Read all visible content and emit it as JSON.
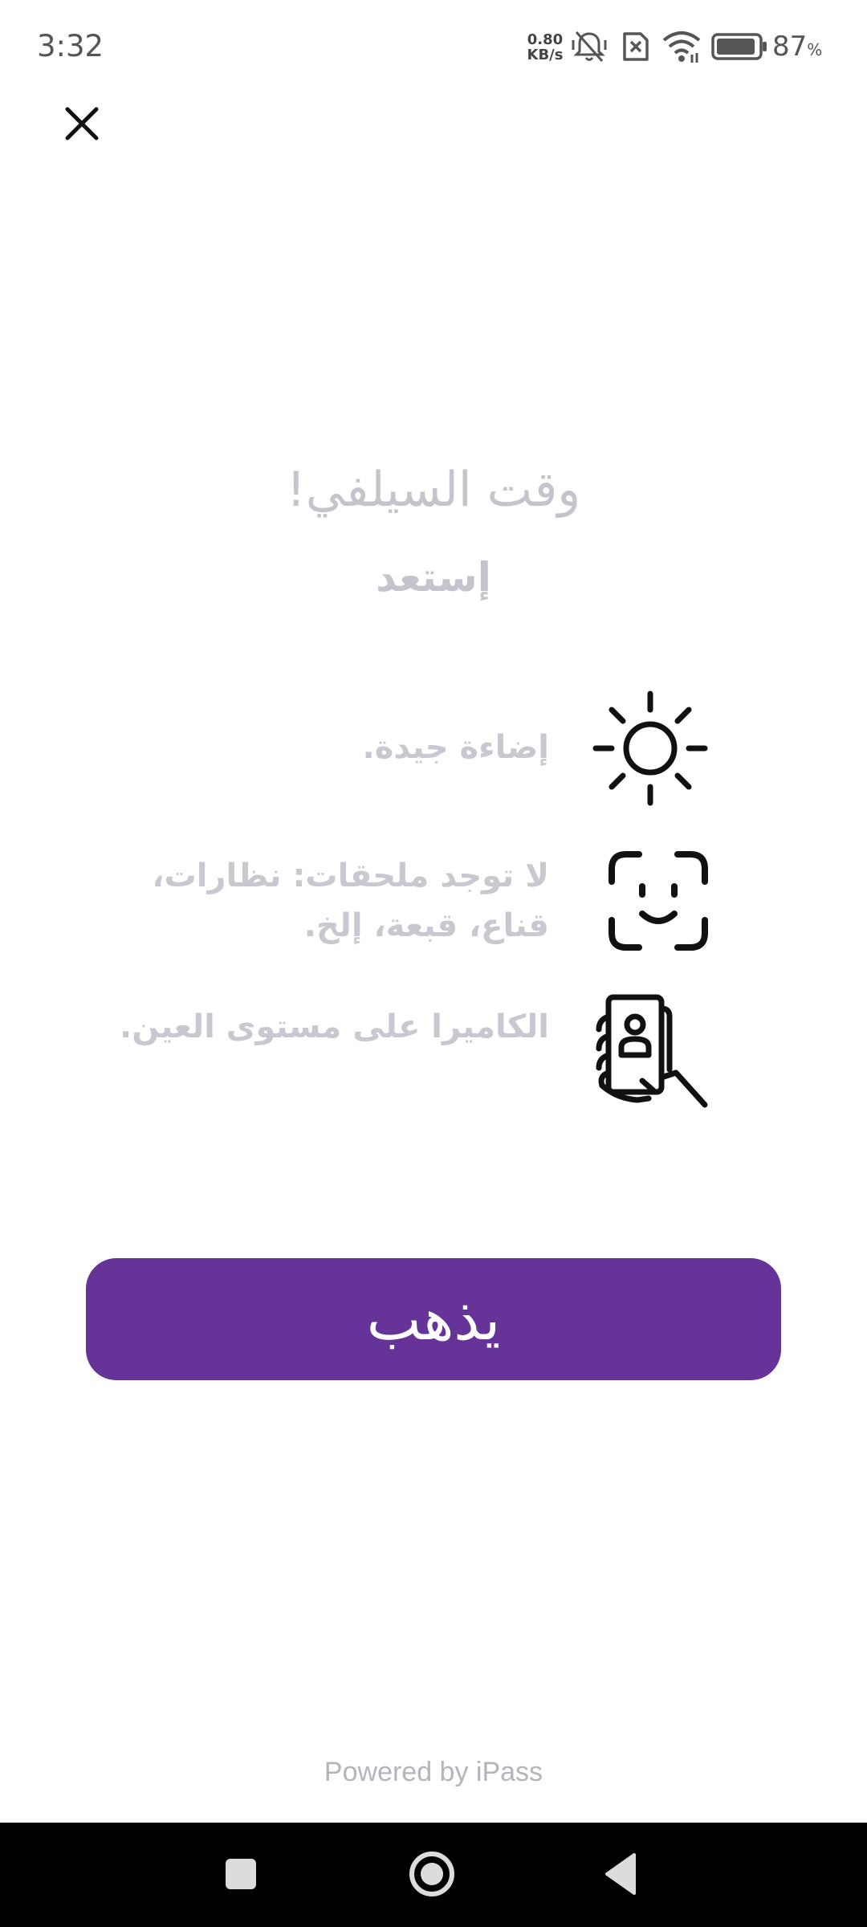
{
  "status_bar": {
    "time": "3:32",
    "net_speed_value": "0.80",
    "net_speed_unit": "KB/s",
    "battery_percent": "87",
    "battery_symbol": "%",
    "icons": [
      "mute-vibrate-icon",
      "sim-error-icon",
      "wifi-icon",
      "battery-icon"
    ]
  },
  "header": {
    "close_icon": "close-icon"
  },
  "main": {
    "title": "وقت السيلفي!",
    "subtitle": "إستعد",
    "tips": [
      {
        "icon": "sun-icon",
        "text": "إضاءة جيدة."
      },
      {
        "icon": "face-scan-icon",
        "text": "لا توجد ملحقات: نظارات، قناع، قبعة، إلخ."
      },
      {
        "icon": "phone-in-hand-icon",
        "text": "الكاميرا على مستوى العين."
      }
    ],
    "go_button_label": "يذهب"
  },
  "footer": {
    "powered_by": "Powered by iPass"
  },
  "nav_bar": {
    "icons": [
      "recents-square-icon",
      "home-circle-icon",
      "back-triangle-icon"
    ]
  },
  "colors": {
    "primary": "#663399",
    "muted_text": "#c4c4cc",
    "background": "#ffffff",
    "nav_background": "#000000"
  }
}
